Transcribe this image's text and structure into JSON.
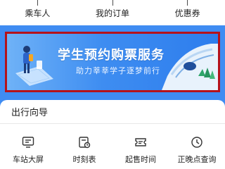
{
  "quick_entries": [
    {
      "label": "乘车人",
      "icon": "passenger-icon"
    },
    {
      "label": "我的订单",
      "icon": "order-icon"
    },
    {
      "label": "优惠券",
      "icon": "coupon-icon"
    }
  ],
  "banner": {
    "title": "学生预约购票服务",
    "subtitle": "助力莘莘学子逐梦前行",
    "accent": "#3e8df1",
    "highlight_border": "#b5121b"
  },
  "guide": {
    "title": "出行向导",
    "items": [
      {
        "label": "车站大屏",
        "icon": "station-screen-icon"
      },
      {
        "label": "时刻表",
        "icon": "timetable-icon"
      },
      {
        "label": "起售时间",
        "icon": "sale-time-icon"
      },
      {
        "label": "正晚点查询",
        "icon": "delay-query-icon"
      }
    ]
  }
}
